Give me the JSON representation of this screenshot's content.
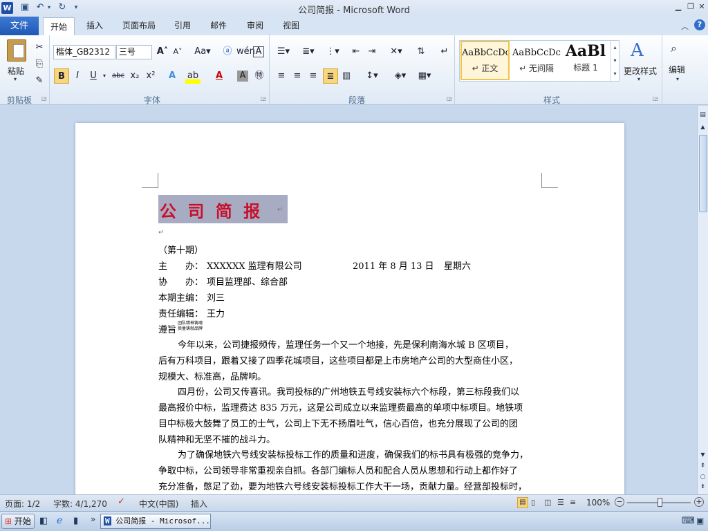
{
  "window": {
    "title": "公司简报 - Microsoft Word"
  },
  "ribbon_tabs": [
    "文件",
    "开始",
    "插入",
    "页面布局",
    "引用",
    "邮件",
    "审阅",
    "视图"
  ],
  "font": {
    "name": "楷体_GB2312",
    "size": "三号"
  },
  "groups": {
    "clipboard": "剪贴板",
    "font": "字体",
    "paragraph": "段落",
    "styles": "样式"
  },
  "clipboard": {
    "paste": "粘贴"
  },
  "styles": [
    {
      "preview": "AaBbCcDc",
      "name": "↵ 正文"
    },
    {
      "preview": "AaBbCcDc",
      "name": "↵ 无间隔"
    },
    {
      "preview": "AaBl",
      "name": "标题 1"
    }
  ],
  "change_styles": "更改样式",
  "editing": "编辑",
  "doc": {
    "heading": "公 司 简 报",
    "issue": "（第十期）",
    "host_label": "主　　办：",
    "host": "XXXXXX 监理有限公司",
    "date": "2011 年 8 月 13 日",
    "weekday": "星期六",
    "co_label": "协　　办：",
    "co": "项目监理部、综合部",
    "editor_label": "本期主编：",
    "editor": "刘三",
    "resp_label": "责任编辑：",
    "resp": "王力",
    "motto_label": "遵旨",
    "motto_top": "团队精神铸魂",
    "motto_bottom": "质量铸就品牌",
    "paras": [
      [
        "今年以来，公司捷报频传，监理任务一个又一个地接，先是保利南海水城 B 区项目，",
        "后有万科项目，跟着又接了四季花城项目，这些项目都是上市房地产公司的大型商住小区，",
        "规模大、标准高，品牌响。"
      ],
      [
        "四月份，公司又传喜讯。我司投标的广州地铁五号线安装标六个标段，第三标段我们以",
        "最高报价中标，监理费达 835 万元，这是公司成立以来监理费最高的单项中标项目。地铁项",
        "目中标极大鼓舞了员工的士气，公司上下无不扬眉吐气，信心百倍，也充分展现了公司的团",
        "队精神和无坚不摧的战斗力。"
      ],
      [
        "为了确保地铁六号线安装标投标工作的质量和进度，确保我们的标书具有极强的竞争力，",
        "争取中标，公司领导非常重视亲自抓。各部门编标人员和配合人员从思想和行动上都作好了",
        "充分准备，憋足了劲，要为地铁六号线安装标投标工作大干一场，贡献力量。经营部投标时，"
      ]
    ]
  },
  "status": {
    "page": "页面: 1/2",
    "words": "字数: 4/1,270",
    "lang": "中文(中国)",
    "mode": "插入",
    "zoom": "100%"
  },
  "taskbar": {
    "start": "开始",
    "task": "公司简报 - Microsof..."
  }
}
